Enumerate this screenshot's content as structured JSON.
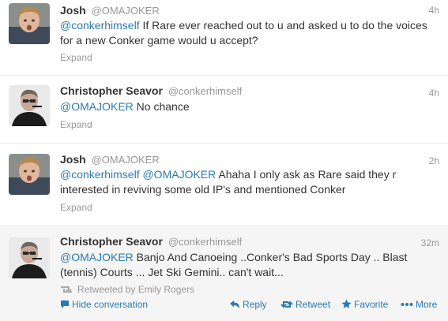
{
  "tweets": [
    {
      "fullname": "Josh",
      "username": "@OMAJOKER",
      "time": "4h",
      "mention": "@conkerhimself",
      "text": " If Rare ever reached out to u and asked u to do the voices for a new Conker game would u accept?",
      "expand_label": "Expand"
    },
    {
      "fullname": "Christopher Seavor",
      "username": "@conkerhimself",
      "time": "4h",
      "mention": "@OMAJOKER",
      "text": " No chance",
      "expand_label": "Expand"
    },
    {
      "fullname": "Josh",
      "username": "@OMAJOKER",
      "time": "2h",
      "mention": "@conkerhimself @OMAJOKER",
      "text": " Ahaha I only ask as Rare said they r interested in reviving some old IP's and mentioned Conker",
      "expand_label": "Expand"
    },
    {
      "fullname": "Christopher Seavor",
      "username": "@conkerhimself",
      "time": "32m",
      "mention": "@OMAJOKER",
      "text": "  Banjo And Canoeing ..Conker's Bad Sports Day .. Blast (tennis) Courts ... Jet Ski Gemini.. can't wait...",
      "retweeted_by": "Retweeted by Emily Rogers",
      "actions": {
        "hide_conversation": "Hide conversation",
        "reply": "Reply",
        "retweet": "Retweet",
        "favorite": "Favorite",
        "more": "More"
      }
    }
  ],
  "colors": {
    "link": "#2a7ab8",
    "muted": "#999999",
    "text": "#333333",
    "expanded_bg": "#f5f5f5"
  }
}
